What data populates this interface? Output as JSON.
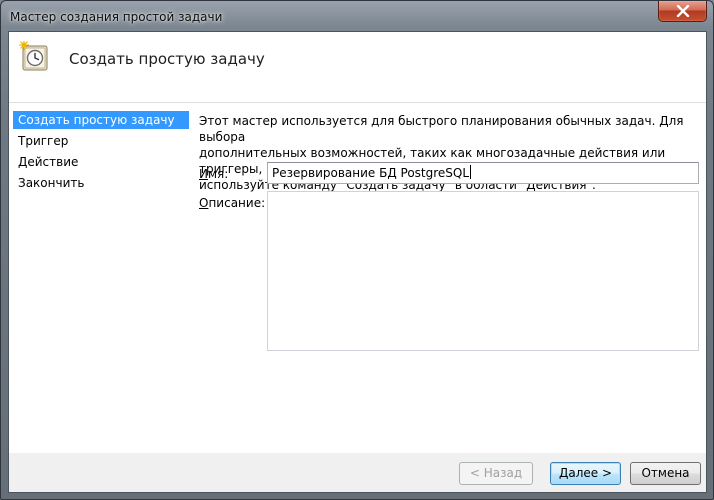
{
  "window": {
    "title": "Мастер создания простой задачи"
  },
  "header": {
    "title": "Создать простую задачу",
    "icon": "task-clock-icon"
  },
  "nav": {
    "items": [
      {
        "label": "Создать простую задачу",
        "selected": true
      },
      {
        "label": "Триггер",
        "selected": false
      },
      {
        "label": "Действие",
        "selected": false
      },
      {
        "label": "Закончить",
        "selected": false
      }
    ]
  },
  "main": {
    "description_lines": [
      "Этот мастер используется для быстрого планирования обычных задач.  Для выбора",
      "дополнительных возможностей, таких как многозадачные действия или триггеры,",
      "используйте команду \"Создать задачу\" в области \"Действия\"."
    ],
    "name_label_underlined": "И",
    "name_label_rest": "мя:",
    "name_value": "Резервирование БД PostgreSQL",
    "description_label_underlined": "О",
    "description_label_rest": "писание:",
    "description_value": ""
  },
  "footer": {
    "back_label": "< Назад",
    "next_label": "Далее >",
    "cancel_label": "Отмена"
  },
  "colors": {
    "selection": "#3399ff",
    "close_button": "#c8502f",
    "default_button_border": "#3c7fb1"
  }
}
